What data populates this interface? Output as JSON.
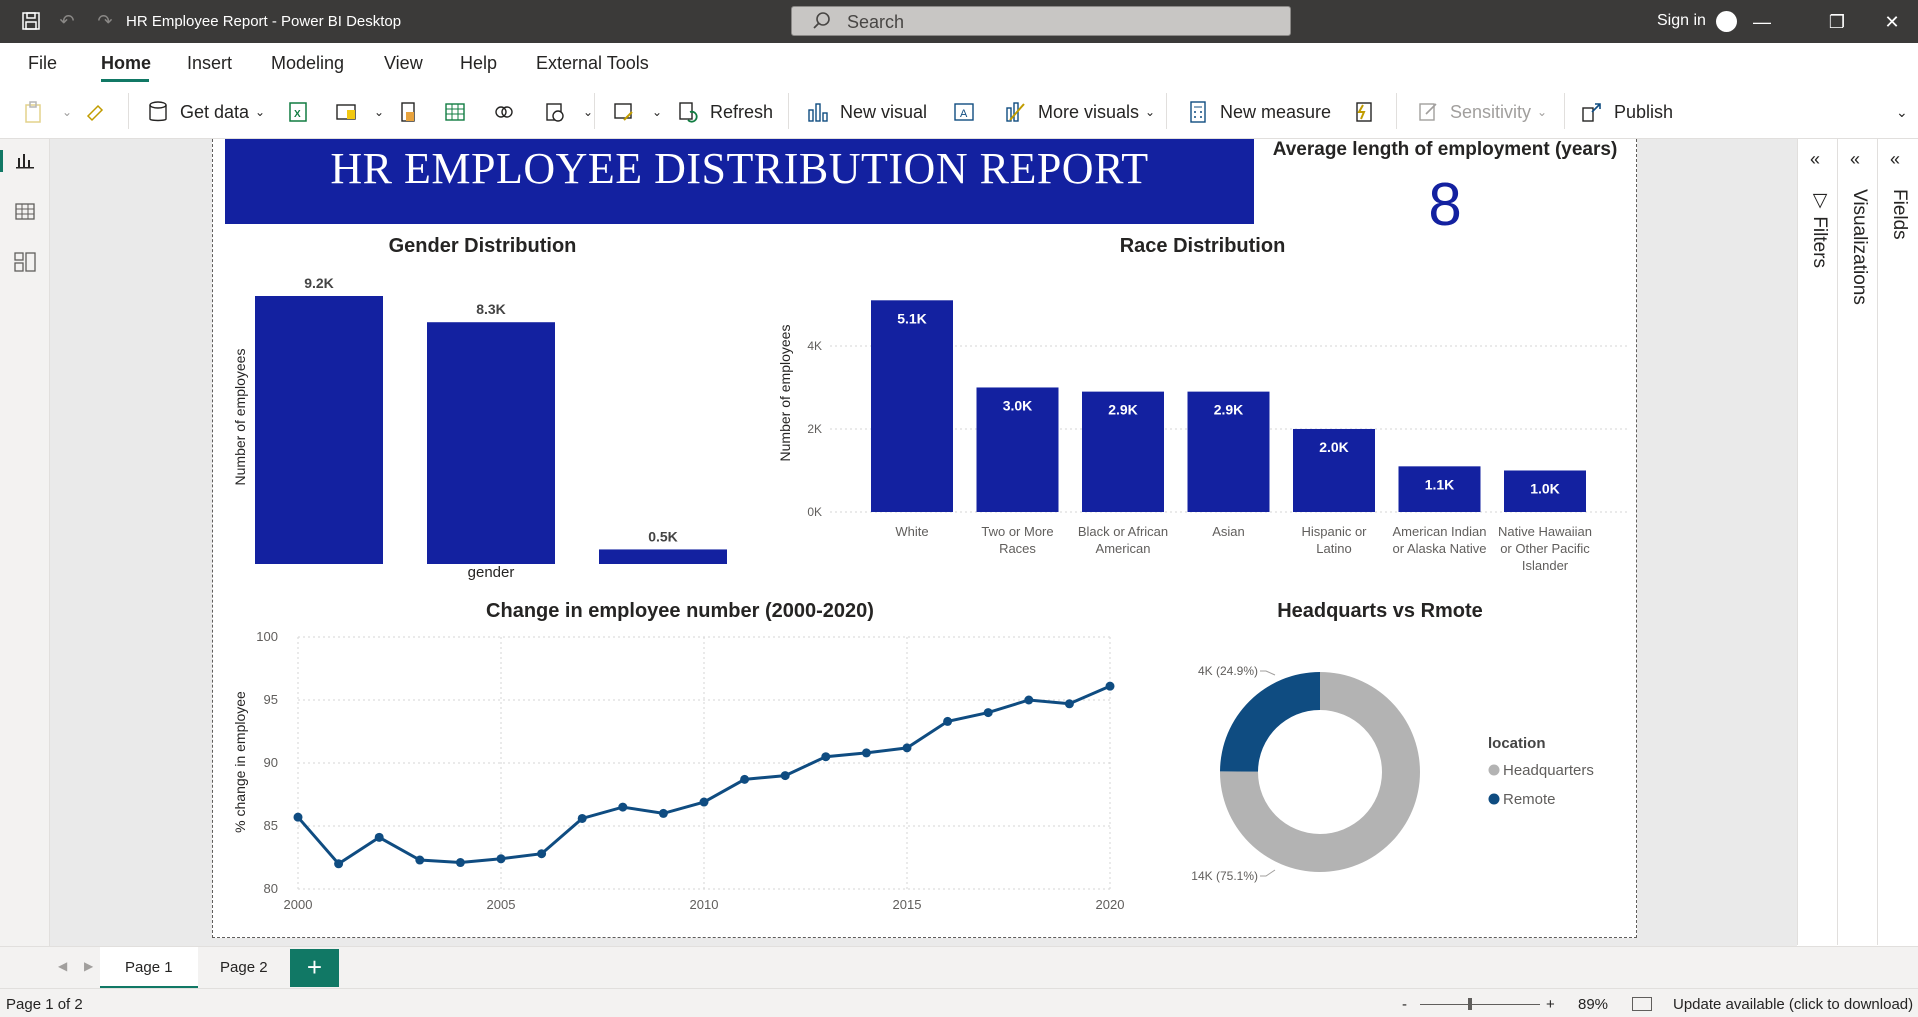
{
  "window": {
    "title": "HR Employee Report - Power BI Desktop",
    "search_placeholder": "Search",
    "sign_in": "Sign in"
  },
  "menu": {
    "items": [
      "File",
      "Home",
      "Insert",
      "Modeling",
      "View",
      "Help",
      "External Tools"
    ],
    "active": "Home"
  },
  "ribbon": {
    "get_data": "Get data",
    "refresh": "Refresh",
    "new_visual": "New visual",
    "more_visuals": "More visuals",
    "new_measure": "New measure",
    "sensitivity": "Sensitivity",
    "publish": "Publish"
  },
  "report": {
    "banner_title": "HR EMPLOYEE DISTRIBUTION REPORT",
    "kpi": {
      "title": "Average length of employment (years)",
      "value": "8"
    }
  },
  "chart_data": [
    {
      "type": "bar",
      "title": "Gender Distribution",
      "xlabel": "gender",
      "ylabel": "Number of employees",
      "categories": [
        "",
        "",
        ""
      ],
      "values": [
        9.2,
        8.3,
        0.5
      ],
      "data_labels": [
        "9.2K",
        "8.3K",
        "0.5K"
      ],
      "ylim": [
        0,
        9.2
      ],
      "color": "#1321a0"
    },
    {
      "type": "bar",
      "title": "Race Distribution",
      "xlabel": "",
      "ylabel": "Number of employees",
      "categories": [
        "White",
        "Two or More Races",
        "Black or African American",
        "Asian",
        "Hispanic or Latino",
        "American Indian or Alaska Native",
        "Native Hawaiian or Other Pacific Islander"
      ],
      "category_lines": [
        [
          "White"
        ],
        [
          "Two or More",
          "Races"
        ],
        [
          "Black or African",
          "American"
        ],
        [
          "Asian"
        ],
        [
          "Hispanic or",
          "Latino"
        ],
        [
          "American Indian",
          "or Alaska Native"
        ],
        [
          "Native Hawaiian",
          "or Other Pacific",
          "Islander"
        ]
      ],
      "values": [
        5100,
        3000,
        2900,
        2900,
        2000,
        1100,
        1000
      ],
      "data_labels": [
        "5.1K",
        "3.0K",
        "2.9K",
        "2.9K",
        "2.0K",
        "1.1K",
        "1.0K"
      ],
      "yticks": [
        "0K",
        "2K",
        "4K"
      ],
      "ytick_values": [
        0,
        2000,
        4000
      ],
      "ylim": [
        0,
        5300
      ],
      "grid": true,
      "color": "#1321a0"
    },
    {
      "type": "line",
      "title": "Change in employee number (2000-2020)",
      "xlabel": "",
      "ylabel": "% change in employee",
      "x": [
        2000,
        2001,
        2002,
        2003,
        2004,
        2005,
        2006,
        2007,
        2008,
        2009,
        2010,
        2011,
        2012,
        2013,
        2014,
        2015,
        2016,
        2017,
        2018,
        2019,
        2020
      ],
      "values": [
        85.7,
        82.0,
        84.1,
        82.3,
        82.1,
        82.4,
        82.8,
        85.6,
        86.5,
        86.0,
        86.9,
        88.7,
        89.0,
        90.5,
        90.8,
        91.2,
        93.3,
        94.0,
        95.0,
        94.7,
        96.1
      ],
      "xticks": [
        2000,
        2005,
        2010,
        2015,
        2020
      ],
      "yticks": [
        80,
        85,
        90,
        95,
        100
      ],
      "ylim": [
        80,
        100
      ],
      "xlim": [
        2000,
        2020
      ],
      "grid": true,
      "color": "#0f4c81"
    },
    {
      "type": "pie",
      "title": "Headquarts vs Rmote",
      "legend_title": "location",
      "legend_placement": "right",
      "labels": [
        "Headquarters",
        "Remote"
      ],
      "values": [
        75.1,
        24.9
      ],
      "data_labels": [
        "14K (75.1%)",
        "4K (24.9%)"
      ],
      "colors": [
        "#b3b3b3",
        "#0f4c81"
      ]
    }
  ],
  "tabs": {
    "pages": [
      "Page 1",
      "Page 2"
    ],
    "active": "Page 1"
  },
  "status": {
    "page_info": "Page 1 of 2",
    "zoom": "89%",
    "update": "Update available (click to download)"
  },
  "panes": {
    "filters": "Filters",
    "visualizations": "Visualizations",
    "fields": "Fields"
  }
}
